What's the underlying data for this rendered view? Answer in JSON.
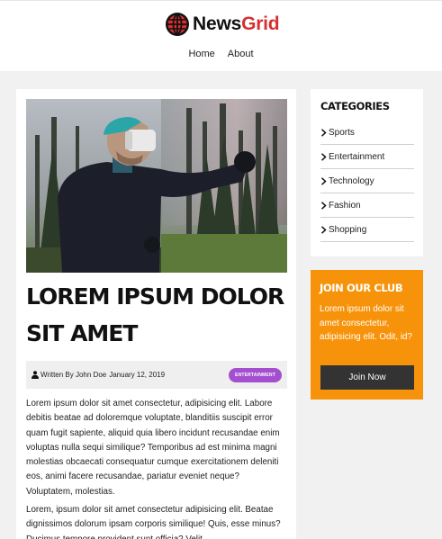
{
  "brand": {
    "name_part1": "News",
    "name_part2": "Grid",
    "logo_icon": "globe-icon",
    "accent_color": "#d63030"
  },
  "nav": {
    "items": [
      {
        "label": "Home"
      },
      {
        "label": "About"
      }
    ]
  },
  "article": {
    "hero_image": "man-wearing-vr-headset-in-forest",
    "title": "Lorem ipsum dolor sit amet",
    "author": "Written By John Doe",
    "date": "January 12, 2019",
    "category_badge": "Entertainment",
    "badge_color": "#a44fd0",
    "paragraphs": [
      "Lorem ipsum dolor sit amet consectetur, adipisicing elit. Labore debitis beatae ad doloremque voluptate, blanditiis suscipit error quam fugit sapiente, aliquid quia libero incidunt recusandae enim voluptas nulla sequi similique? Temporibus ad est minima magni molestias obcaecati consequatur cumque exercitationem deleniti eos, animi facere recusandae, pariatur eveniet neque? Voluptatem, molestias.",
      "Lorem, ipsum dolor sit amet consectetur adipisicing elit. Beatae dignissimos dolorum ipsam corporis similique! Quis, esse minus? Ducimus tempore provident sunt officia? Velit"
    ]
  },
  "sidebar": {
    "categories_title": "Categories",
    "categories": [
      {
        "label": "Sports"
      },
      {
        "label": "Entertainment"
      },
      {
        "label": "Technology"
      },
      {
        "label": "Fashion"
      },
      {
        "label": "Shopping"
      }
    ],
    "club": {
      "title": "Join Our Club",
      "text": "Lorem ipsum dolor sit amet consectetur, adipisicing elit. Odit, id?",
      "button_label": "Join Now",
      "background_color": "#f7930a"
    }
  }
}
